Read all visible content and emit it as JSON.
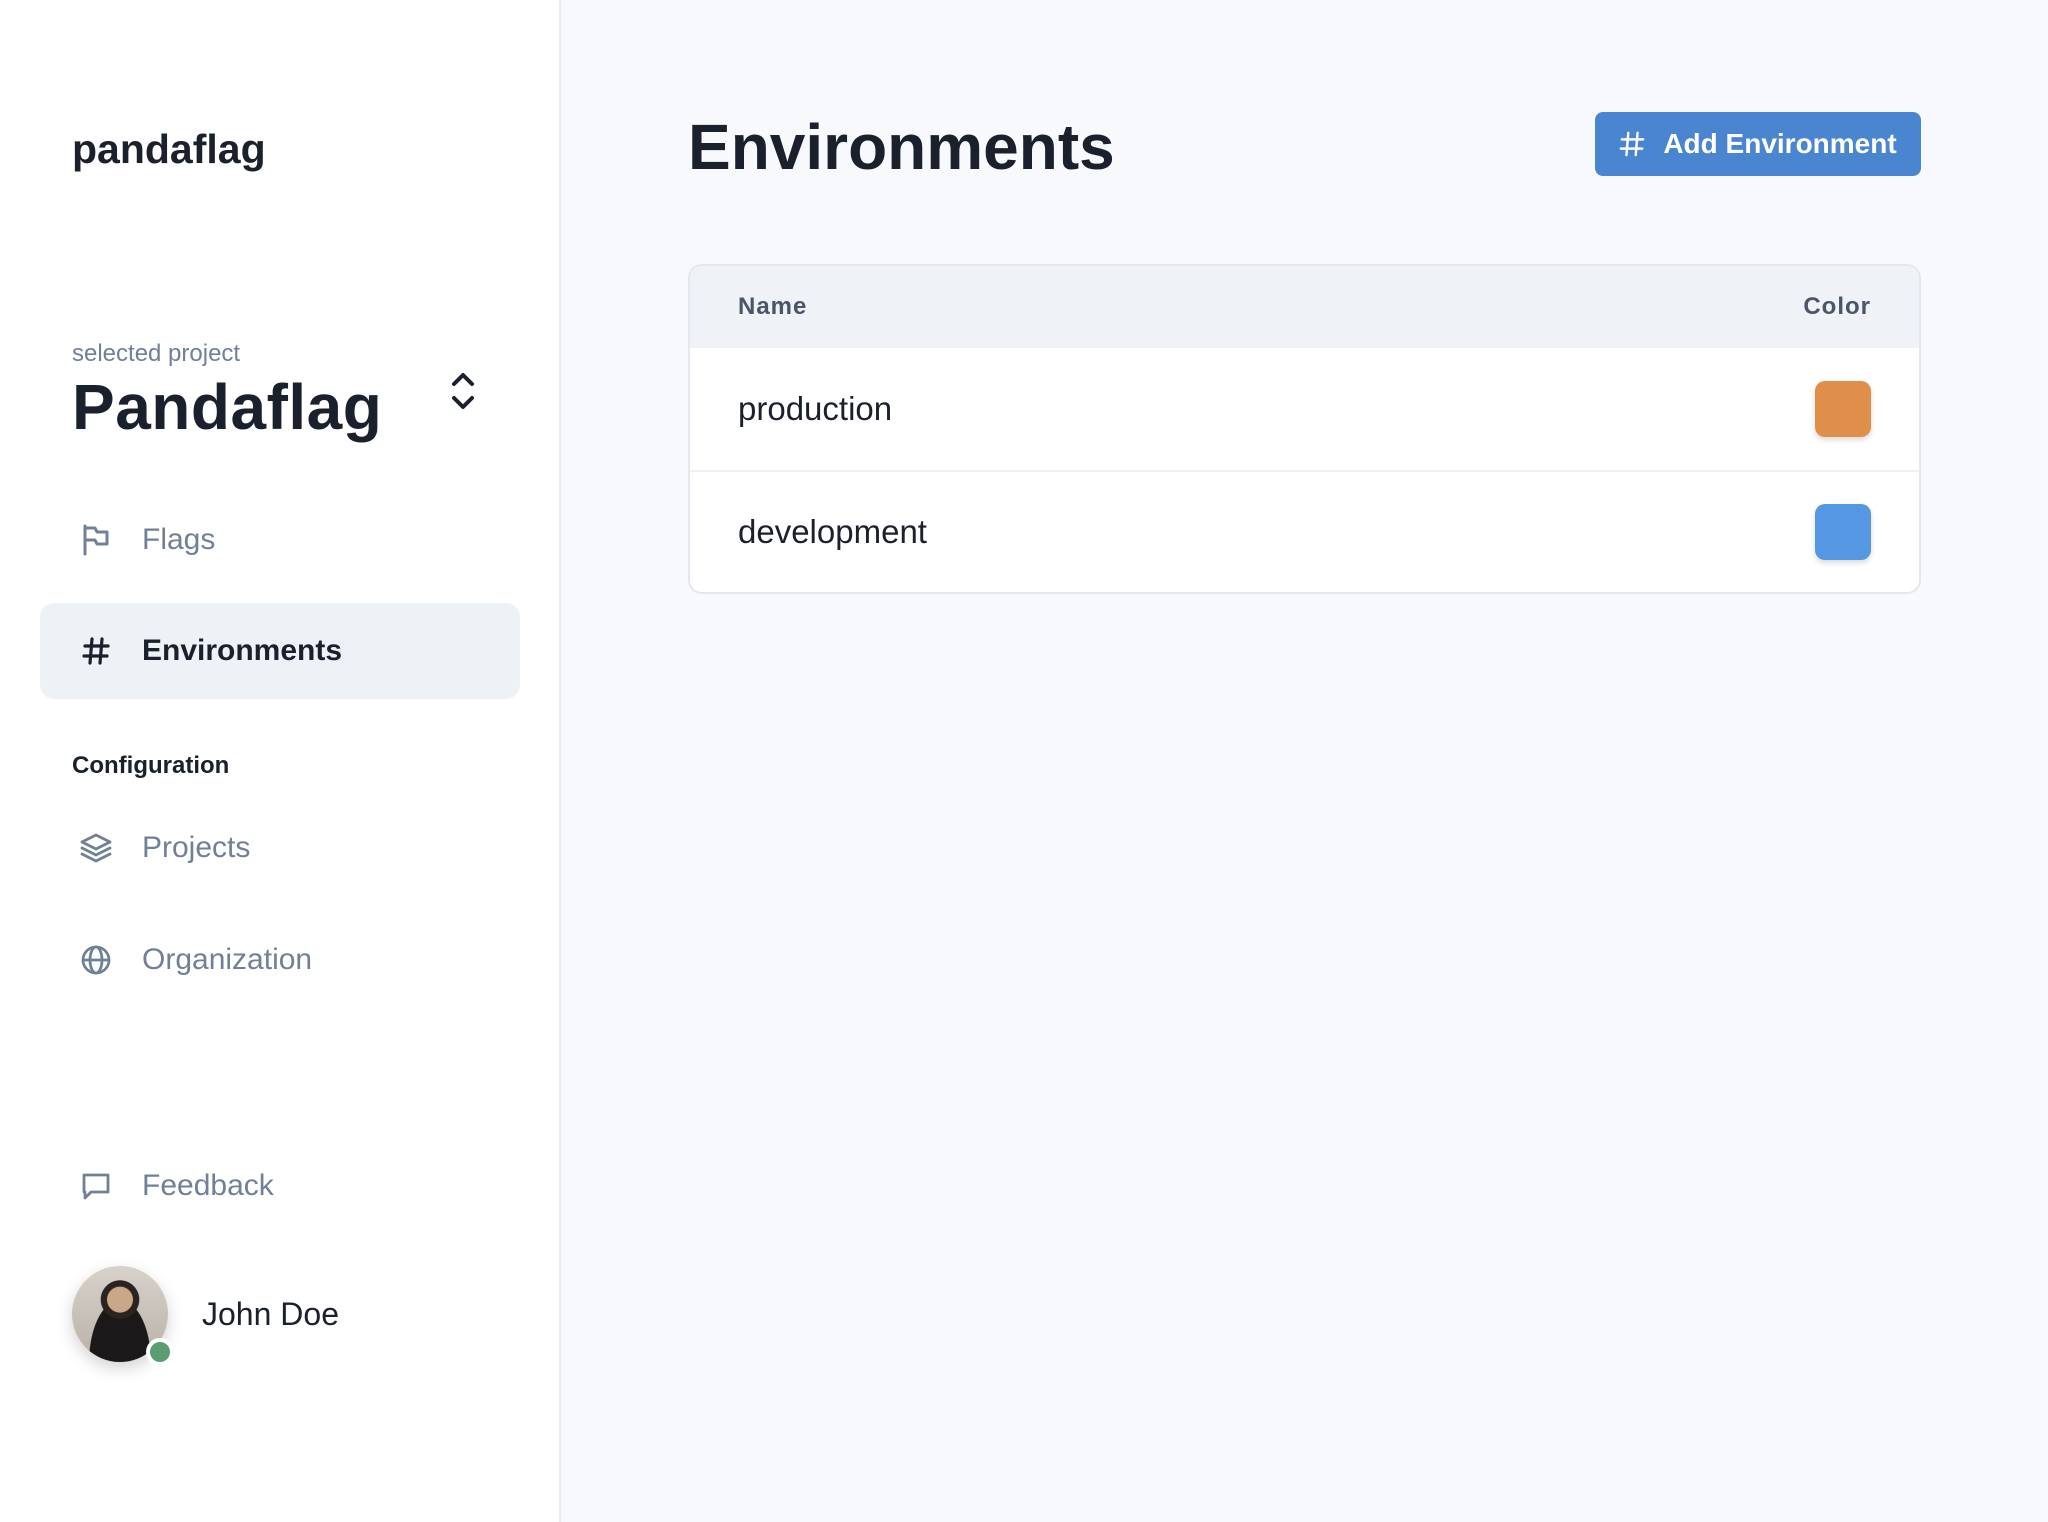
{
  "app": {
    "logo": "pandaflag"
  },
  "project": {
    "label": "selected project",
    "name": "Pandaflag"
  },
  "nav": {
    "flags": "Flags",
    "environments": "Environments",
    "config_title": "Configuration",
    "projects": "Projects",
    "organization": "Organization",
    "feedback": "Feedback"
  },
  "user": {
    "name": "John Doe",
    "status_color": "#5a9e6f"
  },
  "page": {
    "title": "Environments",
    "add_button": "Add Environment"
  },
  "table": {
    "headers": {
      "name": "Name",
      "color": "Color"
    },
    "rows": [
      {
        "name": "production",
        "color": "#e08f4a"
      },
      {
        "name": "development",
        "color": "#5597e2"
      }
    ]
  },
  "colors": {
    "accent": "#4a85d0",
    "text": "#1a202c",
    "muted": "#718096"
  }
}
